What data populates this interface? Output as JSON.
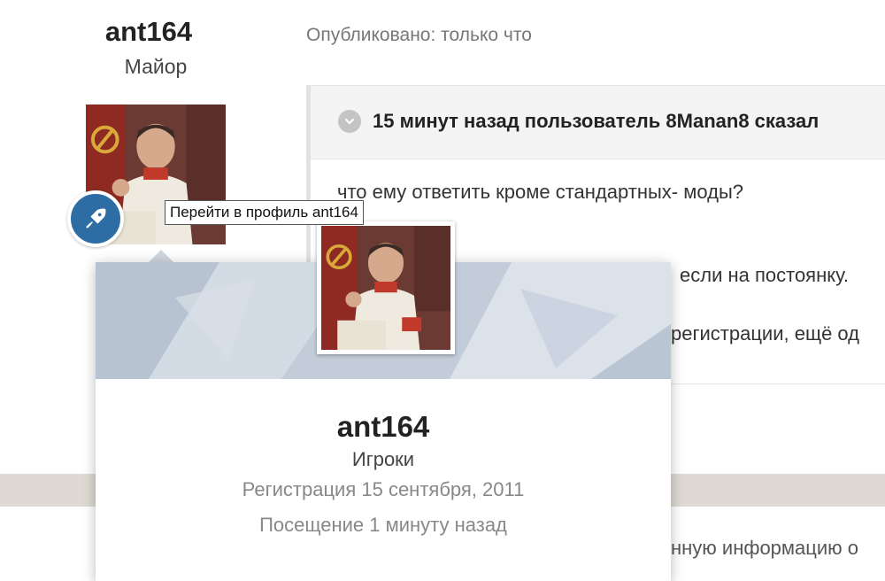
{
  "author": {
    "name": "ant164",
    "rank": "Майор"
  },
  "post": {
    "published": "Опубликовано: только что",
    "quote_header": "15 минут назад пользователь 8Manan8 сказал",
    "lines": [
      "что ему ответить кроме стандартных- моды?",
      "если на постоянку.",
      "регистрации, ещё од",
      "нную информацию о"
    ]
  },
  "tooltip": "Перейти в профиль ant164",
  "hover_card": {
    "name": "ant164",
    "group": "Игроки",
    "registered": "Регистрация 15 сентября, 2011",
    "last_visit": "Посещение 1 минуту назад"
  },
  "colors": {
    "badge": "#2d6da3",
    "bottom_band": "#dedad3",
    "quote_header_bg": "#f4f4f4"
  },
  "icons": {
    "badge": "rocket-icon",
    "quote_toggle": "chevron-down-icon"
  }
}
